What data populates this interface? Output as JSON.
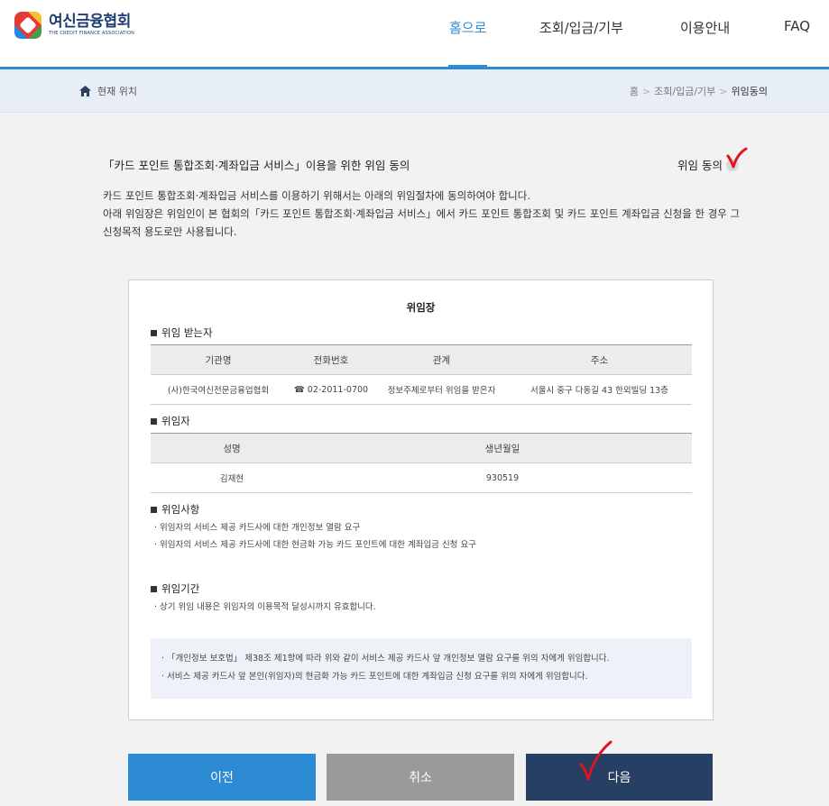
{
  "header": {
    "logo_name": "여신금융협회",
    "logo_sub": "THE CREDIT FINANCE ASSOCIATION",
    "nav": [
      {
        "label": "홈으로",
        "active": true
      },
      {
        "label": "조회/입금/기부",
        "active": false
      },
      {
        "label": "이용안내",
        "active": false
      },
      {
        "label": "FAQ",
        "active": false
      }
    ]
  },
  "location": {
    "label": "현재 위치",
    "breadcrumb": [
      "홈",
      "조회/입금/기부",
      "위임동의"
    ]
  },
  "intro": {
    "title": "「카드 포인트 통합조회·계좌입금 서비스」이용을 위한 위임 동의",
    "agree_label": "위임 동의",
    "desc_line1": "카드 포인트 통합조회·계좌입금 서비스를 이용하기 위해서는 아래의 위임절차에 동의하여야 합니다.",
    "desc_line2": "아래 위임장은 위임인이 본 협회의「카드 포인트 통합조회·계좌입금 서비스」에서 카드 포인트 통합조회 및 카드 포인트 계좌입금 신청을 한 경우 그 신청목적 용도로만 사용됩니다."
  },
  "document": {
    "title": "위임장",
    "grantee": {
      "section_title": "위임 받는자",
      "headers": [
        "기관명",
        "전화번호",
        "관계",
        "주소"
      ],
      "row": [
        "(사)한국여신전문금융업협회",
        "☎ 02-2011-0700",
        "정보주체로부터 위임을 받은자",
        "서울시 중구 다동길 43 한외빌딩 13층"
      ]
    },
    "grantor": {
      "section_title": "위임자",
      "headers": [
        "성명",
        "생년월일"
      ],
      "row": [
        "김재현",
        "930519"
      ]
    },
    "matters": {
      "section_title": "위임사항",
      "items": [
        "위임자의 서비스 제공 카드사에 대한 개인정보 열람 요구",
        "위임자의 서비스 제공 카드사에 대한 현금화 가능 카드 포인트에 대한 계좌입금 신청 요구"
      ]
    },
    "period": {
      "section_title": "위임기간",
      "items": [
        "상기 위임 내용은 위임자의 이용목적 달성시까지 유효합니다."
      ]
    },
    "notice": [
      "「개인정보 보호법」 제38조 제1항에 따라 위와 같이 서비스 제공 카드사 앞 개인정보 열람 요구를 위의 자에게 위임합니다.",
      "서비스 제공 카드사 앞 본인(위임자)의 현금화 가능 카드 포인트에 대한 계좌입금 신청 요구를 위의 자에게 위임합니다."
    ]
  },
  "buttons": {
    "prev": "이전",
    "cancel": "취소",
    "next": "다음"
  },
  "colors": {
    "accent": "#2d8bd3",
    "navy": "#263f63",
    "gray_button": "#9a9a9a",
    "check_mark": "#e0141e"
  }
}
